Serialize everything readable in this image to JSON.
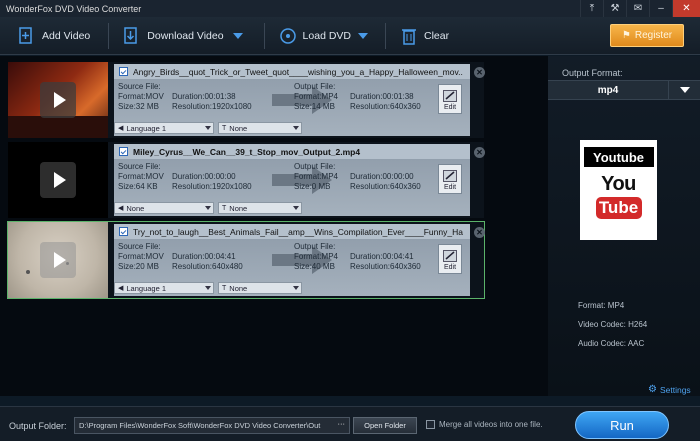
{
  "window": {
    "title": "WonderFox DVD Video Converter"
  },
  "toolbar": {
    "add_video": "Add Video",
    "download_video": "Download Video",
    "load_dvd": "Load DVD",
    "clear": "Clear",
    "register": "Register"
  },
  "labels": {
    "source_file": "Source File:",
    "output_file": "Output File:",
    "edit": "Edit"
  },
  "items": [
    {
      "filename": "Angry_Birds__quot_Trick_or_Tweet_quot____wishing_you_a_Happy_Halloween_mov...",
      "source": {
        "format": "Format:MOV",
        "duration": "Duration:00:01:38",
        "size": "Size:32 MB",
        "resolution": "Resolution:1920x1080"
      },
      "output": {
        "format": "Format:MP4",
        "duration": "Duration:00:01:38",
        "size": "Size:14 MB",
        "resolution": "Resolution:640x360"
      },
      "audio": "Language 1",
      "subtitle": "None"
    },
    {
      "filename": "Miley_Cyrus__We_Can__39_t_Stop_mov_Output_2.mp4",
      "source": {
        "format": "Format:MOV",
        "duration": "Duration:00:00:00",
        "size": "Size:64 KB",
        "resolution": "Resolution:1920x1080"
      },
      "output": {
        "format": "Format:MP4",
        "duration": "Duration:00:00:00",
        "size": "Size:0 MB",
        "resolution": "Resolution:640x360"
      },
      "audio": "None",
      "subtitle": "None"
    },
    {
      "filename": "Try_not_to_laugh__Best_Animals_Fail__amp__Wins_Compilation_Ever____Funny_Haha...",
      "source": {
        "format": "Format:MOV",
        "duration": "Duration:00:04:41",
        "size": "Size:20 MB",
        "resolution": "Resolution:640x480"
      },
      "output": {
        "format": "Format:MP4",
        "duration": "Duration:00:04:41",
        "size": "Size:40 MB",
        "resolution": "Resolution:640x360"
      },
      "audio": "Language 1",
      "subtitle": "None"
    }
  ],
  "right_panel": {
    "output_format_label": "Output Format:",
    "output_format_value": "mp4",
    "logo_top": "Youtube",
    "logo_you": "You",
    "logo_tube": "Tube",
    "format": "Format: MP4",
    "video_codec": "Video Codec: H264",
    "audio_codec": "Audio Codec: AAC",
    "settings": "Settings"
  },
  "bottom": {
    "output_folder_label": "Output Folder:",
    "output_path": "D:\\Program Files\\WonderFox Soft\\WonderFox DVD Video Converter\\Out",
    "browse": "···",
    "open_folder": "Open Folder",
    "merge": "Merge all videos into one file.",
    "run": "Run"
  },
  "colors": {
    "accent": "#1e7ad8",
    "register": "#f0a030",
    "selected_border": "#5bb36a"
  }
}
